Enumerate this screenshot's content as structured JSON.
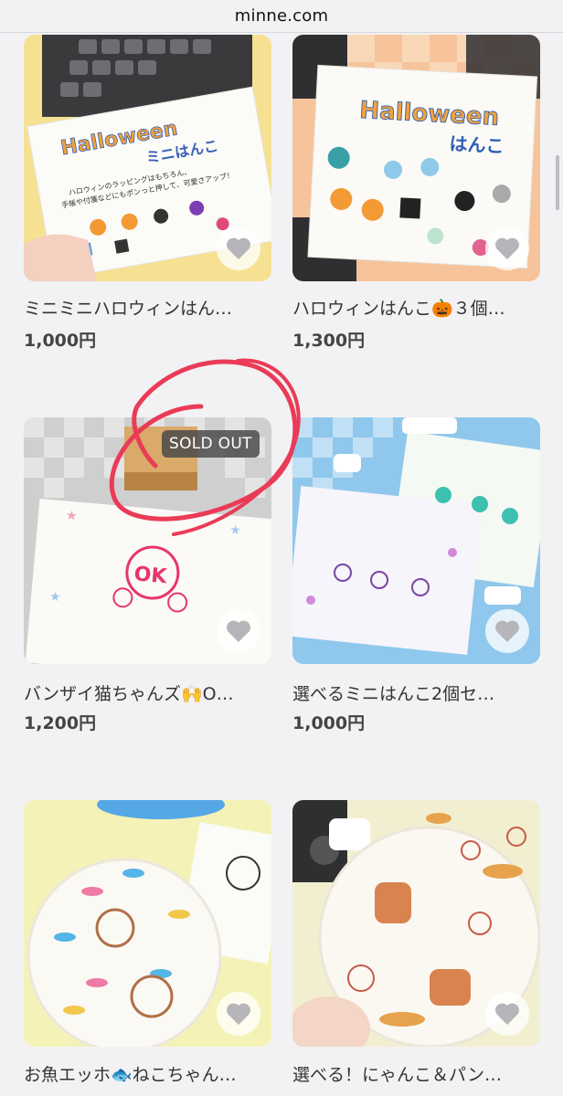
{
  "browser": {
    "url": "minne.com"
  },
  "products": [
    {
      "title": "ミニミニハロウィンはん…",
      "price": "1,000円",
      "sold_out": false,
      "image_text": {
        "line1": "Halloween",
        "line2": "ミニはんこ",
        "body1": "ハロウィンのラッピングはもちろん、",
        "body2": "手帳や付箋などにもポンっと押して、可愛さアップ！"
      }
    },
    {
      "title": "ハロウィンはんこ🎃３個…",
      "price": "1,300円",
      "sold_out": false,
      "image_text": {
        "line1": "Halloween",
        "line2": "はんこ"
      }
    },
    {
      "title": "バンザイ猫ちゃんズ🙌O…",
      "price": "1,200円",
      "sold_out": true,
      "badge": "SOLD OUT",
      "image_text": {
        "stamp": "OK"
      }
    },
    {
      "title": "選べるミニはんこ2個セ…",
      "price": "1,000円",
      "sold_out": false
    },
    {
      "title": "お魚エッホ🐟ねこちゃん…",
      "price": "",
      "sold_out": false
    },
    {
      "title": "選べる！にゃんこ＆パン…",
      "price": "",
      "sold_out": false
    }
  ]
}
